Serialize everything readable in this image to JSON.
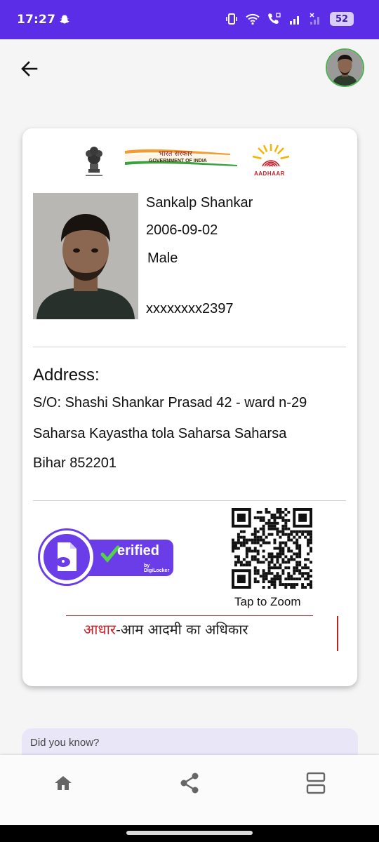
{
  "status_bar": {
    "time": "17:27",
    "battery": "52",
    "icons": [
      "snapchat-icon",
      "vibrate-icon",
      "wifi-icon",
      "wifi-calling-icon",
      "signal-icon",
      "signal-no-service-icon",
      "battery-icon"
    ]
  },
  "header": {
    "back_icon": "arrow-left-icon",
    "avatar_alt": "profile-avatar"
  },
  "card": {
    "gov_hindi": "भारत सरकार",
    "gov_english": "GOVERNMENT OF INDIA",
    "aadhaar_logo_text": "AADHAAR",
    "name": "Sankalp Shankar",
    "dob": "2006-09-02",
    "gender": "Male",
    "aadhaar_number": "xxxxxxxx2397",
    "address_title": "Address:",
    "address_lines": [
      "S/O: Shashi Shankar Prasad 42 - ward n-29",
      "Saharsa Kayastha tola Saharsa Saharsa",
      "Bihar 852201"
    ],
    "verified_word": "erified",
    "verified_sub": "by DigiLocker",
    "tap_to_zoom": "Tap to Zoom",
    "slogan_red": "आधार",
    "slogan_rest": "-आम आदमी का अधिकार"
  },
  "did_you_know": {
    "title": "Did you know?"
  },
  "bottom_nav": {
    "items": [
      "home-icon",
      "share-icon",
      "layout-icon"
    ]
  },
  "colors": {
    "status_bar": "#5b2de6",
    "digilocker_purple": "#6a3de8",
    "avatar_ring": "#4caf50",
    "aadhaar_red": "#c8202a"
  }
}
